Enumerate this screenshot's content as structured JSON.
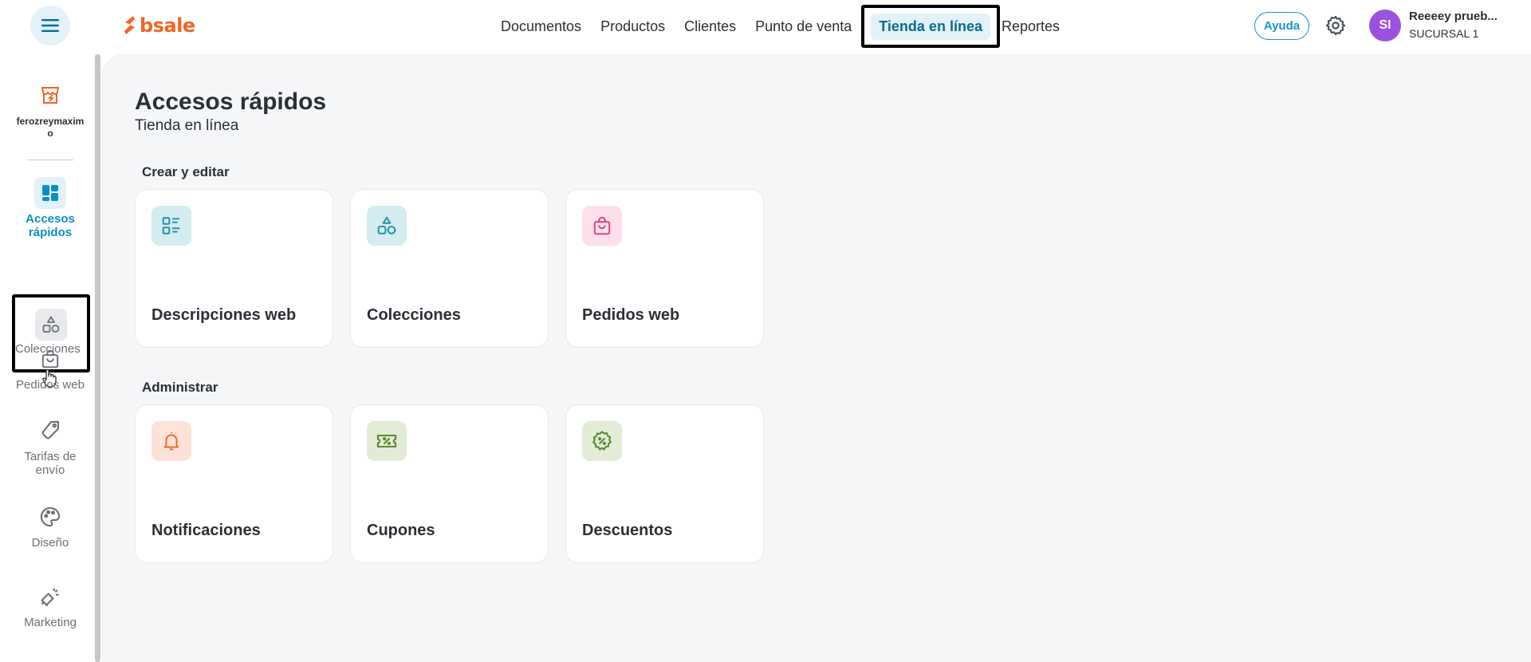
{
  "header": {
    "logo_text": "bsale",
    "nav": [
      {
        "label": "Documentos"
      },
      {
        "label": "Productos"
      },
      {
        "label": "Clientes"
      },
      {
        "label": "Punto de venta"
      },
      {
        "label": "Tienda en línea"
      },
      {
        "label": "Reportes"
      }
    ],
    "help_label": "Ayuda",
    "user": {
      "initials": "SI",
      "name": "Reeeey prueb...",
      "branch": "SUCURSAL 1"
    }
  },
  "sidebar": {
    "store_name": "ferozreymaximo",
    "items": [
      {
        "label": "Accesos rápidos",
        "icon": "dashboard-icon"
      },
      {
        "label": "Colecciones",
        "icon": "shapes-icon"
      },
      {
        "label": "Pedidos web",
        "icon": "shopping-bag-icon"
      },
      {
        "label": "Tarifas de envío",
        "icon": "tag-icon"
      },
      {
        "label": "Diseño",
        "icon": "palette-icon"
      },
      {
        "label": "Marketing",
        "icon": "megaphone-icon"
      }
    ]
  },
  "main": {
    "title": "Accesos rápidos",
    "subtitle": "Tienda en línea",
    "sections": [
      {
        "title": "Crear y editar",
        "cards": [
          {
            "label": "Descripciones web",
            "icon": "list-icon",
            "bg": "#d3edf1",
            "fg": "#1f8fa6"
          },
          {
            "label": "Colecciones",
            "icon": "shapes-icon",
            "bg": "#d3edf1",
            "fg": "#1f8fa6"
          },
          {
            "label": "Pedidos web",
            "icon": "shopping-bag-icon",
            "bg": "#fde0ec",
            "fg": "#e0407f"
          }
        ]
      },
      {
        "title": "Administrar",
        "cards": [
          {
            "label": "Notificaciones",
            "icon": "bell-icon",
            "bg": "#fde2d8",
            "fg": "#f26522"
          },
          {
            "label": "Cupones",
            "icon": "coupon-icon",
            "bg": "#e2ecd6",
            "fg": "#5d8a2e"
          },
          {
            "label": "Descuentos",
            "icon": "discount-badge-icon",
            "bg": "#e2ecd6",
            "fg": "#5d8a2e"
          }
        ]
      }
    ]
  },
  "colors": {
    "accent": "#1894c9",
    "brand": "#f26522",
    "avatar": "#9b51e0"
  }
}
